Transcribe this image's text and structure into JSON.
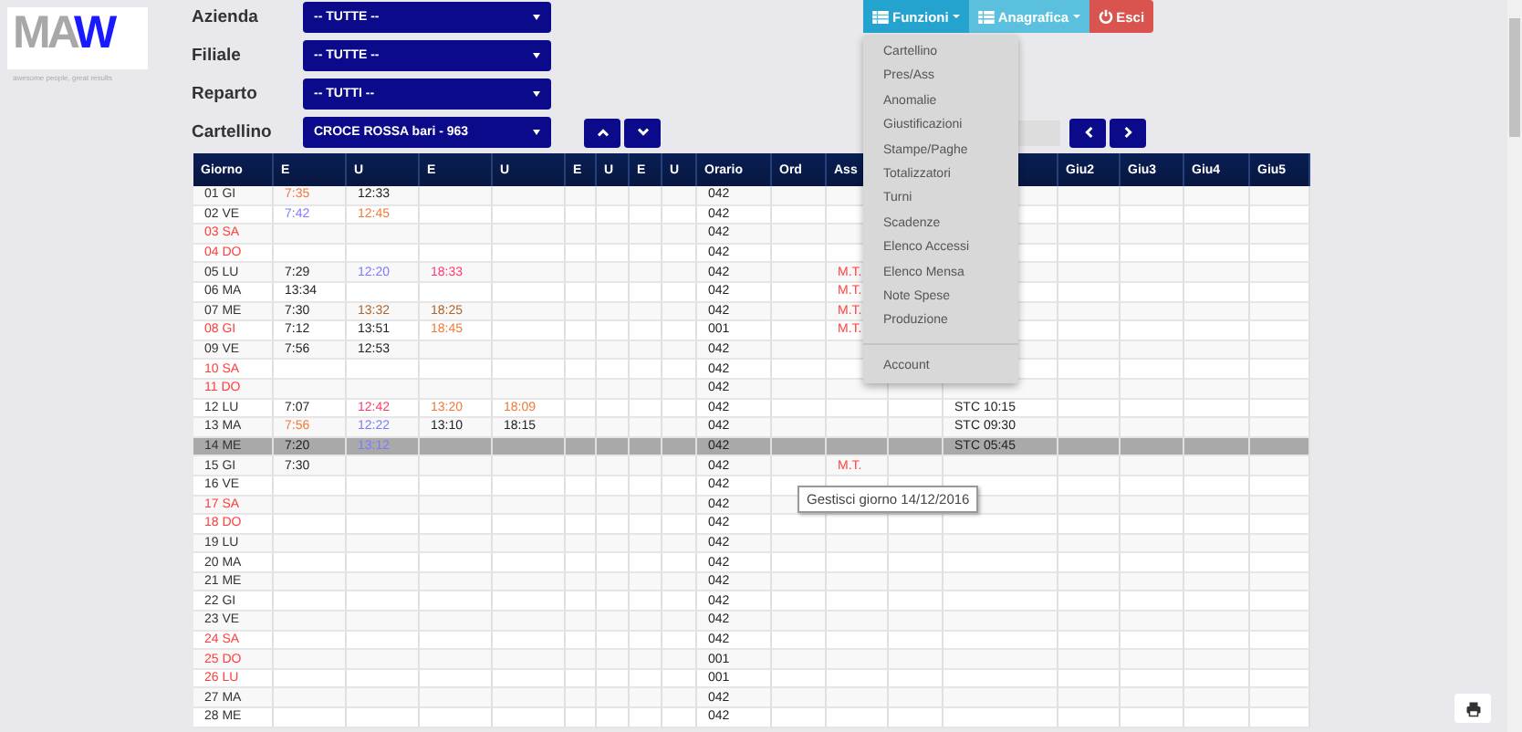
{
  "logo": {
    "parts": [
      {
        "text": "MA",
        "color": "#a8a8a8"
      },
      {
        "text": "W",
        "color": "#1a1aff"
      }
    ],
    "tagline": "awesome people, great results"
  },
  "filters": [
    {
      "label": "Azienda",
      "value": "-- TUTTE --"
    },
    {
      "label": "Filiale",
      "value": "-- TUTTE --"
    },
    {
      "label": "Reparto",
      "value": "-- TUTTI --"
    },
    {
      "label": "Cartellino",
      "value": "CROCE ROSSA bari - 963"
    }
  ],
  "top_buttons": [
    {
      "label": "Funzioni",
      "kind": "menu",
      "expanded": true
    },
    {
      "label": "Anagrafica",
      "kind": "menu",
      "expanded": false
    },
    {
      "label": "Esci",
      "kind": "exit"
    }
  ],
  "menu": [
    {
      "kind": "item",
      "label": "Cartellino"
    },
    {
      "kind": "item",
      "label": "Pres/Ass"
    },
    {
      "kind": "item",
      "label": "Anomalie"
    },
    {
      "kind": "item",
      "label": "Giustificazioni"
    },
    {
      "kind": "item",
      "label": "Stampe/Paghe"
    },
    {
      "kind": "item",
      "label": "Totalizzatori"
    },
    {
      "kind": "item",
      "label": "Turni"
    },
    {
      "kind": "item",
      "label": "Scadenze"
    },
    {
      "kind": "item",
      "label": "Elenco Accessi"
    },
    {
      "kind": "item",
      "label": "Elenco Mensa"
    },
    {
      "kind": "item",
      "label": "Note Spese"
    },
    {
      "kind": "item",
      "label": "Produzione"
    },
    {
      "kind": "divider"
    },
    {
      "kind": "item",
      "label": "Account"
    }
  ],
  "table": {
    "columns": [
      "Giorno",
      "E",
      "U",
      "E",
      "U",
      "E",
      "U",
      "E",
      "U",
      "Orario",
      "Ord",
      "Ass",
      null,
      null,
      "Giu2",
      "Giu3",
      "Giu4",
      "Giu5"
    ],
    "rows": [
      {
        "day": "01 GI",
        "holiday": false,
        "selected": false,
        "cells": [
          {
            "text": "7:35",
            "color": "#f07a3a"
          },
          "12:33",
          null,
          null,
          null,
          null,
          null,
          null,
          "042",
          null,
          null,
          null,
          null,
          null,
          null,
          null,
          null
        ]
      },
      {
        "day": "02 VE",
        "holiday": false,
        "selected": false,
        "cells": [
          {
            "text": "7:42",
            "color": "#7a7aff"
          },
          {
            "text": "12:45",
            "color": "#f07a3a"
          },
          null,
          null,
          null,
          null,
          null,
          null,
          "042",
          null,
          null,
          null,
          null,
          null,
          null,
          null,
          null
        ]
      },
      {
        "day": "03 SA",
        "holiday": true,
        "selected": false,
        "cells": [
          null,
          null,
          null,
          null,
          null,
          null,
          null,
          null,
          "042",
          null,
          null,
          null,
          null,
          null,
          null,
          null,
          null
        ]
      },
      {
        "day": "04 DO",
        "holiday": true,
        "selected": false,
        "cells": [
          null,
          null,
          null,
          null,
          null,
          null,
          null,
          null,
          "042",
          null,
          null,
          null,
          null,
          null,
          null,
          null,
          null
        ]
      },
      {
        "day": "05 LU",
        "holiday": false,
        "selected": false,
        "cells": [
          "7:29",
          {
            "text": "12:20",
            "color": "#7a7aff"
          },
          {
            "text": "18:33",
            "color": "#ff3a6a"
          },
          null,
          null,
          null,
          null,
          null,
          "042",
          null,
          {
            "text": "M.T.",
            "color": "#ff4040"
          },
          null,
          null,
          null,
          null,
          null,
          null
        ]
      },
      {
        "day": "06 MA",
        "holiday": false,
        "selected": false,
        "cells": [
          "13:34",
          null,
          null,
          null,
          null,
          null,
          null,
          null,
          "042",
          null,
          {
            "text": "M.T.",
            "color": "#ff4040"
          },
          null,
          null,
          null,
          null,
          null,
          null
        ]
      },
      {
        "day": "07 ME",
        "holiday": false,
        "selected": false,
        "cells": [
          "7:30",
          {
            "text": "13:32",
            "color": "#b0642a"
          },
          {
            "text": "18:25",
            "color": "#b0642a"
          },
          null,
          null,
          null,
          null,
          null,
          "042",
          null,
          {
            "text": "M.T.",
            "color": "#ff4040"
          },
          null,
          null,
          null,
          null,
          null,
          null
        ]
      },
      {
        "day": "08 GI",
        "holiday": true,
        "selected": false,
        "cells": [
          "7:12",
          "13:51",
          {
            "text": "18:45",
            "color": "#f07a3a"
          },
          null,
          null,
          null,
          null,
          null,
          "001",
          null,
          {
            "text": "M.T.",
            "color": "#ff4040"
          },
          null,
          null,
          null,
          null,
          null,
          null
        ]
      },
      {
        "day": "09 VE",
        "holiday": false,
        "selected": false,
        "cells": [
          "7:56",
          "12:53",
          null,
          null,
          null,
          null,
          null,
          null,
          "042",
          null,
          null,
          null,
          null,
          null,
          null,
          null,
          null
        ]
      },
      {
        "day": "10 SA",
        "holiday": true,
        "selected": false,
        "cells": [
          null,
          null,
          null,
          null,
          null,
          null,
          null,
          null,
          "042",
          null,
          null,
          null,
          null,
          null,
          null,
          null,
          null
        ]
      },
      {
        "day": "11 DO",
        "holiday": true,
        "selected": false,
        "cells": [
          null,
          null,
          null,
          null,
          null,
          null,
          null,
          null,
          "042",
          null,
          null,
          null,
          null,
          null,
          null,
          null,
          null
        ]
      },
      {
        "day": "12 LU",
        "holiday": false,
        "selected": false,
        "cells": [
          "7:07",
          {
            "text": "12:42",
            "color": "#ff3a6a"
          },
          {
            "text": "13:20",
            "color": "#f07a3a"
          },
          {
            "text": "18:09",
            "color": "#f07a3a"
          },
          null,
          null,
          null,
          null,
          "042",
          null,
          null,
          null,
          "STC 10:15",
          null,
          null,
          null,
          null
        ]
      },
      {
        "day": "13 MA",
        "holiday": false,
        "selected": false,
        "cells": [
          {
            "text": "7:56",
            "color": "#f07a3a"
          },
          {
            "text": "12:22",
            "color": "#7a7aff"
          },
          "13:10",
          "18:15",
          null,
          null,
          null,
          null,
          "042",
          null,
          null,
          null,
          "STC 09:30",
          null,
          null,
          null,
          null
        ]
      },
      {
        "day": "14 ME",
        "holiday": false,
        "selected": true,
        "cells": [
          "7:20",
          {
            "text": "13:12",
            "color": "#7a7aff"
          },
          null,
          null,
          null,
          null,
          null,
          null,
          "042",
          null,
          null,
          null,
          "STC 05:45",
          null,
          null,
          null,
          null
        ]
      },
      {
        "day": "15 GI",
        "holiday": false,
        "selected": false,
        "cells": [
          "7:30",
          null,
          null,
          null,
          null,
          null,
          null,
          null,
          "042",
          null,
          {
            "text": "M.T.",
            "color": "#ff4040"
          },
          null,
          null,
          null,
          null,
          null,
          null
        ]
      },
      {
        "day": "16 VE",
        "holiday": false,
        "selected": false,
        "cells": [
          null,
          null,
          null,
          null,
          null,
          null,
          null,
          null,
          "042",
          null,
          null,
          null,
          null,
          null,
          null,
          null,
          null
        ]
      },
      {
        "day": "17 SA",
        "holiday": true,
        "selected": false,
        "cells": [
          null,
          null,
          null,
          null,
          null,
          null,
          null,
          null,
          "042",
          null,
          null,
          null,
          null,
          null,
          null,
          null,
          null
        ]
      },
      {
        "day": "18 DO",
        "holiday": true,
        "selected": false,
        "cells": [
          null,
          null,
          null,
          null,
          null,
          null,
          null,
          null,
          "042",
          null,
          null,
          null,
          null,
          null,
          null,
          null,
          null
        ]
      },
      {
        "day": "19 LU",
        "holiday": false,
        "selected": false,
        "cells": [
          null,
          null,
          null,
          null,
          null,
          null,
          null,
          null,
          "042",
          null,
          null,
          null,
          null,
          null,
          null,
          null,
          null
        ]
      },
      {
        "day": "20 MA",
        "holiday": false,
        "selected": false,
        "cells": [
          null,
          null,
          null,
          null,
          null,
          null,
          null,
          null,
          "042",
          null,
          null,
          null,
          null,
          null,
          null,
          null,
          null
        ]
      },
      {
        "day": "21 ME",
        "holiday": false,
        "selected": false,
        "cells": [
          null,
          null,
          null,
          null,
          null,
          null,
          null,
          null,
          "042",
          null,
          null,
          null,
          null,
          null,
          null,
          null,
          null
        ]
      },
      {
        "day": "22 GI",
        "holiday": false,
        "selected": false,
        "cells": [
          null,
          null,
          null,
          null,
          null,
          null,
          null,
          null,
          "042",
          null,
          null,
          null,
          null,
          null,
          null,
          null,
          null
        ]
      },
      {
        "day": "23 VE",
        "holiday": false,
        "selected": false,
        "cells": [
          null,
          null,
          null,
          null,
          null,
          null,
          null,
          null,
          "042",
          null,
          null,
          null,
          null,
          null,
          null,
          null,
          null
        ]
      },
      {
        "day": "24 SA",
        "holiday": true,
        "selected": false,
        "cells": [
          null,
          null,
          null,
          null,
          null,
          null,
          null,
          null,
          "042",
          null,
          null,
          null,
          null,
          null,
          null,
          null,
          null
        ]
      },
      {
        "day": "25 DO",
        "holiday": true,
        "selected": false,
        "cells": [
          null,
          null,
          null,
          null,
          null,
          null,
          null,
          null,
          "001",
          null,
          null,
          null,
          null,
          null,
          null,
          null,
          null
        ]
      },
      {
        "day": "26 LU",
        "holiday": true,
        "selected": false,
        "cells": [
          null,
          null,
          null,
          null,
          null,
          null,
          null,
          null,
          "001",
          null,
          null,
          null,
          null,
          null,
          null,
          null,
          null
        ]
      },
      {
        "day": "27 MA",
        "holiday": false,
        "selected": false,
        "cells": [
          null,
          null,
          null,
          null,
          null,
          null,
          null,
          null,
          "042",
          null,
          null,
          null,
          null,
          null,
          null,
          null,
          null
        ]
      },
      {
        "day": "28 ME",
        "holiday": false,
        "selected": false,
        "cells": [
          null,
          null,
          null,
          null,
          null,
          null,
          null,
          null,
          "042",
          null,
          null,
          null,
          null,
          null,
          null,
          null,
          null
        ]
      }
    ]
  },
  "tooltip": "Gestisci giorno 14/12/2016"
}
